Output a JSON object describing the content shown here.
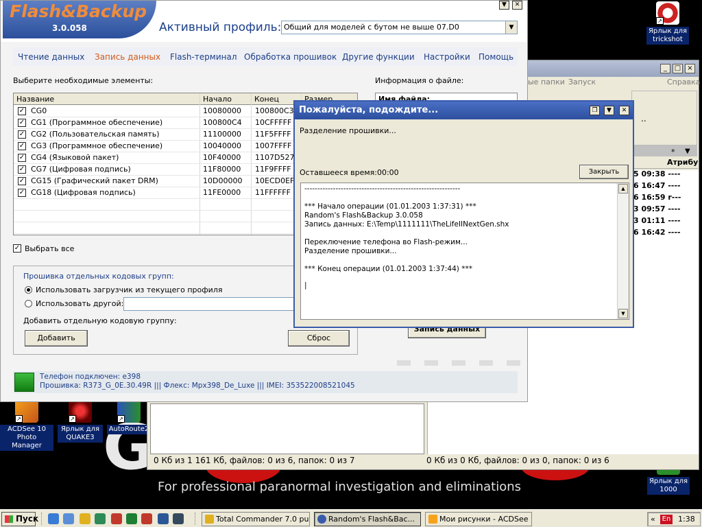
{
  "desktop": {
    "icons": [
      {
        "label": "Ярлык для trickshot"
      },
      {
        "label": "ACDSee 10 Photo Manager"
      },
      {
        "label": "Ярлык для QUAKE3"
      },
      {
        "label": "AutoRoute2"
      },
      {
        "label": "Ярлык для 1000"
      }
    ],
    "wallpaper": {
      "letter": "G",
      "tagline": "For professional paranormal investigation and eliminations"
    }
  },
  "total_commander": {
    "menu": [
      "ые папки",
      "Запуск",
      "Справка"
    ],
    "column_header": "Атрибу",
    "rows": [
      "5 09:38 ----",
      "6 16:47 ----",
      "6 16:59 r---",
      "3 09:57 ----",
      "3 01:11 ----",
      "6 16:42 ----"
    ],
    "status_left": "0 Кб из 1 161 Кб, файлов: 0 из 6, папок: 0 из 7",
    "status_right": "0 Кб из 0 Кб, файлов: 0 из 0, папок: 0 из 6",
    "drive_label": "..",
    "sort_label": "*"
  },
  "app": {
    "logo": "Flash&Backup",
    "version": "3.0.058",
    "profile_label": "Активный профиль:",
    "profile_value": "Общий для моделей с бутом не выше 07.D0",
    "nav": [
      {
        "label": "Чтение данных",
        "active": false
      },
      {
        "label": "Запись данных",
        "active": true
      },
      {
        "label": "Flash-терминал",
        "active": false
      },
      {
        "label": "Обработка прошивок",
        "active": false
      },
      {
        "label": "Другие функции",
        "active": false
      },
      {
        "label": "Настройки",
        "active": false
      },
      {
        "label": "Помощь",
        "active": false
      }
    ],
    "select_elements_label": "Выберите необходимые элементы:",
    "file_info_label": "Информация о файле:",
    "file_name_label": "Имя файла:",
    "columns": [
      "Название",
      "Начало",
      "Конец",
      "Размер"
    ],
    "rows": [
      {
        "name": "CG0",
        "start": "10080000",
        "end": "100800C3",
        "checked": true
      },
      {
        "name": "CG1 (Программное обеспечение)",
        "start": "100800C4",
        "end": "10CFFFFF",
        "checked": true
      },
      {
        "name": "CG2 (Пользовательская память)",
        "start": "11100000",
        "end": "11F5FFFF",
        "checked": true
      },
      {
        "name": "CG3 (Программное обеспечение)",
        "start": "10040000",
        "end": "1007FFFF",
        "checked": true
      },
      {
        "name": "CG4 (Языковой пакет)",
        "start": "10F40000",
        "end": "1107D527",
        "checked": true
      },
      {
        "name": "CG7 (Цифровая подпись)",
        "start": "11F80000",
        "end": "11F9FFFF",
        "checked": true
      },
      {
        "name": "CG15 (Графический пакет DRM)",
        "start": "10D00000",
        "end": "10ECD0EF",
        "checked": true
      },
      {
        "name": "CG18 (Цифровая подпись)",
        "start": "11FE0000",
        "end": "11FFFFFF",
        "checked": true
      }
    ],
    "select_all_label": "Выбрать все",
    "group_title": "Прошивка отдельных кодовых групп:",
    "radio_current": "Использовать загрузчик из текущего профиля",
    "radio_other": "Использовать другой:",
    "add_group_label": "Добавить отдельную кодовую группу:",
    "add_button": "Добавить",
    "reset_button": "Сброс",
    "write_button": "Запись данных",
    "status_line1": "Телефон подключен: e398",
    "status_line2": "Прошивка: R373_G_0E.30.49R ||| Флекс: Mpx398_De_Luxe ||| IMEI: 353522008521045"
  },
  "dialog": {
    "title": "Пожалуйста, подождите...",
    "message": "Разделение прошивки...",
    "time_left": "Оставшееся время:00:00",
    "close_button": "Закрыть",
    "log": [
      "------------------------------------------------------------",
      "",
      "*** Начало операции (01.01.2003 1:37:31) ***",
      "Random's Flash&Backup 3.0.058",
      "Запись данных: E:\\Temp\\1111111\\TheLifeIINextGen.shx",
      "",
      "Переключение телефона во Flash-режим...",
      "Разделение прошивки...",
      "",
      "*** Конец операции (01.01.2003 1:37:44) ***",
      "",
      "|"
    ]
  },
  "taskbar": {
    "start": "Пуск",
    "tasks": [
      {
        "label": "Total Commander 7.0 pu...",
        "active": false
      },
      {
        "label": "Random's Flash&Bac...",
        "active": true
      },
      {
        "label": "Мои рисунки - ACDSee ...",
        "active": false
      }
    ],
    "tray_arrow": "«",
    "lang": "En",
    "clock": "1:38"
  }
}
